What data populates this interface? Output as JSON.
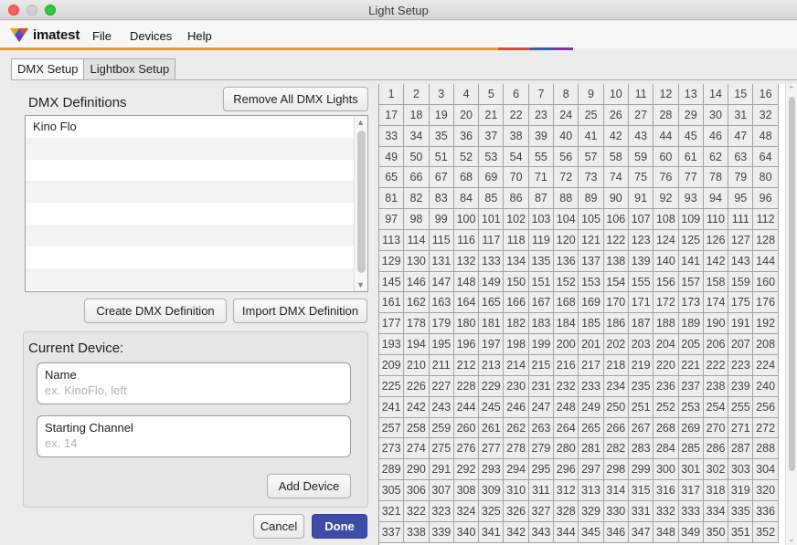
{
  "window": {
    "title": "Light Setup"
  },
  "app": {
    "logo_text": "imatest"
  },
  "menu": [
    "File",
    "Devices",
    "Help"
  ],
  "tabs": [
    {
      "label": "DMX Setup",
      "active": true
    },
    {
      "label": "Lightbox Setup",
      "active": false
    }
  ],
  "dmx": {
    "title": "DMX Definitions",
    "remove_all_label": "Remove All DMX Lights",
    "definitions": [
      "Kino Flo",
      "",
      "",
      "",
      "",
      "",
      "",
      ""
    ],
    "create_label": "Create DMX Definition",
    "import_label": "Import DMX Definition"
  },
  "device": {
    "title": "Current Device:",
    "name_label": "Name",
    "name_placeholder": "ex. KinoFlo, left",
    "name_value": "",
    "channel_label": "Starting Channel",
    "channel_placeholder": "ex. 14",
    "channel_value": "",
    "add_label": "Add Device"
  },
  "footer": {
    "cancel_label": "Cancel",
    "done_label": "Done"
  },
  "channel_grid": {
    "columns": 16,
    "first_channel": 1,
    "last_channel": 352
  },
  "colors": {
    "accent": "#3e4ca7",
    "stripe": [
      "#f29b1f",
      "#e7472a",
      "#2f5db8",
      "#8a2fb3"
    ],
    "traffic": [
      "#fe5f57",
      "#d0d0d0",
      "#2bc840"
    ]
  },
  "icons": {
    "close": "close-icon",
    "minimize": "minimize-icon",
    "maximize": "maximize-icon",
    "logo": "imatest-logo-icon",
    "scroll_up": "chevron-up-icon",
    "scroll_down": "chevron-down-icon"
  }
}
